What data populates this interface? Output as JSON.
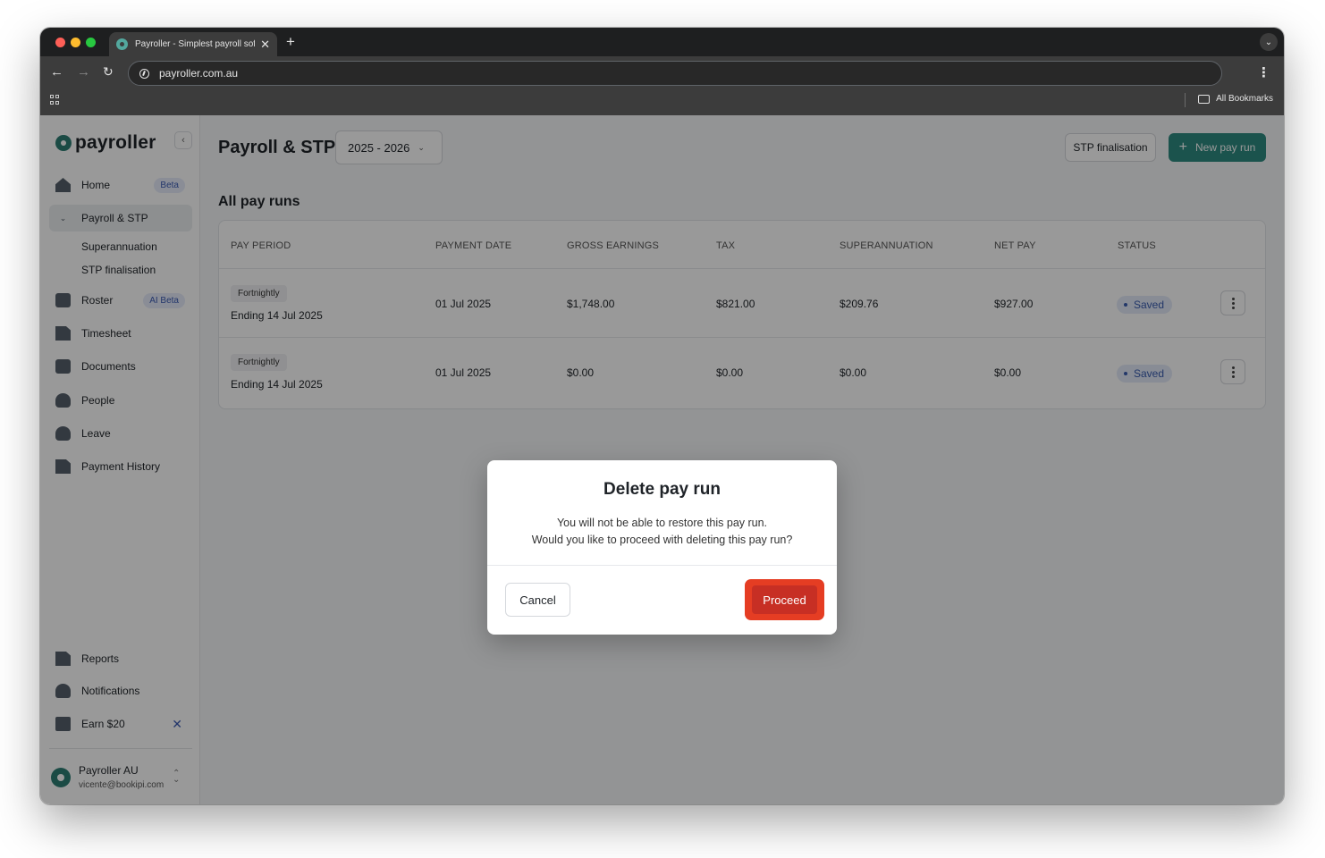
{
  "browser": {
    "tab_title": "Payroller - Simplest payroll software",
    "url": "payroller.com.au",
    "bookmarks_label": "All Bookmarks"
  },
  "sidebar": {
    "logo_text": "payroller",
    "nav": {
      "home": {
        "label": "Home",
        "badge": "Beta"
      },
      "payroll": {
        "label": "Payroll & STP"
      },
      "superannuation": {
        "label": "Superannuation"
      },
      "stp_finalisation": {
        "label": "STP finalisation"
      },
      "roster": {
        "label": "Roster",
        "badge": "AI Beta"
      },
      "timesheet": {
        "label": "Timesheet"
      },
      "documents": {
        "label": "Documents"
      },
      "people": {
        "label": "People"
      },
      "leave": {
        "label": "Leave"
      },
      "payment_history": {
        "label": "Payment History"
      },
      "reports": {
        "label": "Reports"
      },
      "notifications": {
        "label": "Notifications"
      },
      "earn": {
        "label": "Earn $20"
      }
    },
    "account": {
      "name": "Payroller AU",
      "email": "vicente@bookipi.com"
    }
  },
  "main": {
    "title": "Payroll & STP",
    "year_select": "2025 - 2026",
    "stp_button": "STP finalisation",
    "new_pay_run_button": "New pay run",
    "section_title": "All pay runs",
    "table": {
      "headers": {
        "pay_period": "PAY PERIOD",
        "payment_date": "PAYMENT DATE",
        "gross": "GROSS EARNINGS",
        "tax": "TAX",
        "super": "SUPERANNUATION",
        "net": "NET PAY",
        "status": "STATUS"
      },
      "rows": [
        {
          "frequency": "Fortnightly",
          "period": "Ending 14 Jul 2025",
          "payment_date": "01 Jul 2025",
          "gross": "$1,748.00",
          "tax": "$821.00",
          "super": "$209.76",
          "net": "$927.00",
          "status": "Saved"
        },
        {
          "frequency": "Fortnightly",
          "period": "Ending 14 Jul 2025",
          "payment_date": "01 Jul 2025",
          "gross": "$0.00",
          "tax": "$0.00",
          "super": "$0.00",
          "net": "$0.00",
          "status": "Saved"
        }
      ]
    }
  },
  "modal": {
    "title": "Delete pay run",
    "line1": "You will not be able to restore this pay run.",
    "line2": "Would you like to proceed with deleting this pay run?",
    "cancel": "Cancel",
    "proceed": "Proceed"
  },
  "colors": {
    "brand": "#2e7d74",
    "primary_button": "#2e8b80",
    "danger": "#c72f24",
    "status_badge": "#3a5cb0"
  }
}
